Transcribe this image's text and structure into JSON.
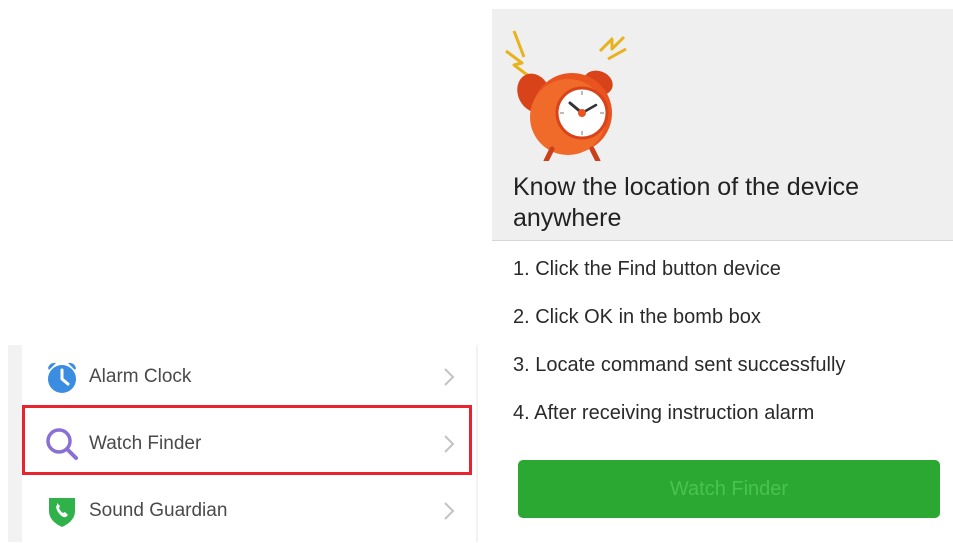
{
  "menu": {
    "items": [
      {
        "label": "Alarm Clock",
        "icon": "alarm-clock-icon",
        "icon_color": "#3a8de0"
      },
      {
        "label": "Watch Finder",
        "icon": "search-icon",
        "icon_color": "#8a6fd6",
        "highlighted": true
      },
      {
        "label": "Sound Guardian",
        "icon": "shield-phone-icon",
        "icon_color": "#2fb24a"
      }
    ]
  },
  "finder": {
    "title": "Know the location of the device anywhere",
    "steps": [
      "1. Click the Find button device",
      "2. Click OK in the bomb box",
      "3. Locate command sent successfully",
      "4. After receiving instruction alarm"
    ],
    "button_label": "Watch Finder"
  },
  "colors": {
    "highlight": "#e8222e",
    "button_bg": "#2ba832",
    "button_text": "#49c34f",
    "alarm_orange": "#e9531f"
  }
}
